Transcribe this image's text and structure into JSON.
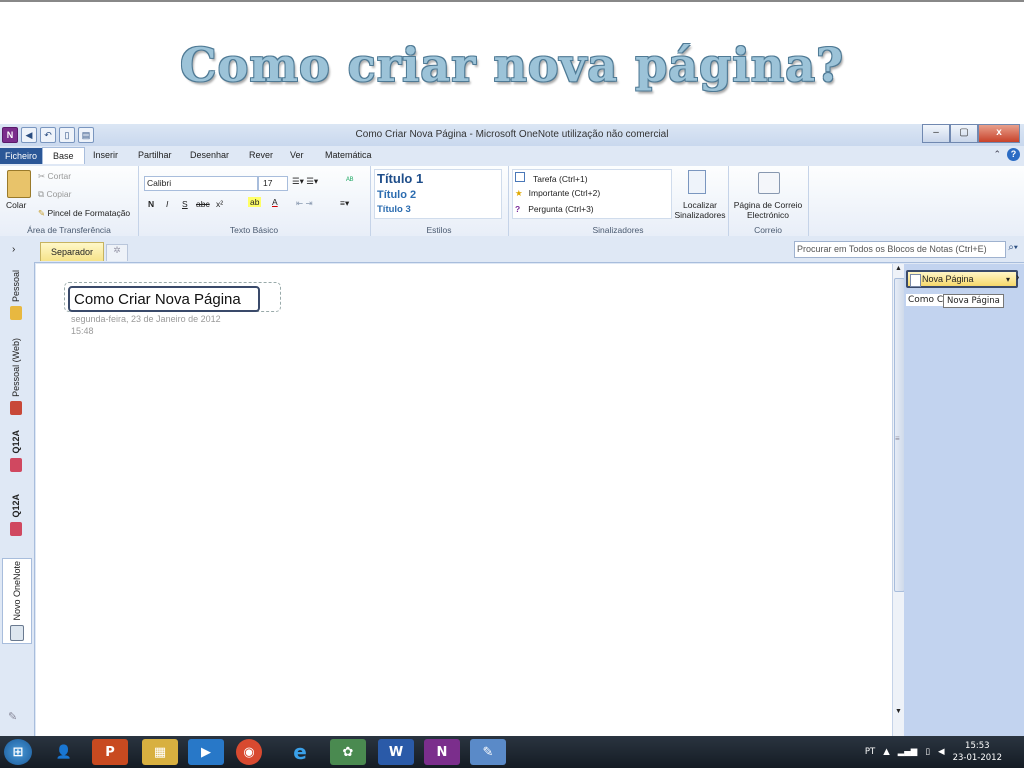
{
  "slide": {
    "title": "Como criar nova página?"
  },
  "window": {
    "title": "Como Criar Nova Página - Microsoft OneNote utilização não comercial",
    "min": "–",
    "max": "▢",
    "close": "x"
  },
  "tabs": {
    "file": "Ficheiro",
    "items": [
      "Base",
      "Inserir",
      "Partilhar",
      "Desenhar",
      "Rever",
      "Ver",
      "Matemática"
    ]
  },
  "clipboard": {
    "paste": "Colar",
    "cut": "Cortar",
    "copy": "Copiar",
    "format_painter": "Pincel de Formatação",
    "label": "Área de Transferência"
  },
  "font": {
    "name": "Calibri",
    "size": "17",
    "bold": "N",
    "italic": "I",
    "underline": "S",
    "strike": "abc",
    "sup": "x²",
    "label": "Texto Básico"
  },
  "styles": {
    "h1": "Título 1",
    "h2": "Título 2",
    "h3": "Título 3",
    "label": "Estilos"
  },
  "tags": {
    "task": "Tarefa (Ctrl+1)",
    "important": "Importante (Ctrl+2)",
    "question": "Pergunta (Ctrl+3)",
    "find": "Localizar Sinalizadores",
    "label": "Sinalizadores"
  },
  "mail": {
    "page": "Página de Correio Electrónico",
    "label": "Correio"
  },
  "section_tab": "Separador",
  "search": {
    "placeholder": "Procurar em Todos os Blocos de Notas (Ctrl+E)"
  },
  "notebooks": [
    "Pessoal",
    "Pessoal (Web)",
    "Q12A",
    "Q12A",
    "Novo OneNote"
  ],
  "page": {
    "title": "Como Criar Nova Página",
    "date": "segunda-feira, 23 de Janeiro de 2012",
    "time": "15:48"
  },
  "pages_pane": {
    "new_page": "Nova Página",
    "item": "Como Criar No",
    "tooltip": "Nova Página"
  },
  "taskbar": {
    "lang": "PT",
    "time": "15:53",
    "date": "23-01-2012"
  }
}
